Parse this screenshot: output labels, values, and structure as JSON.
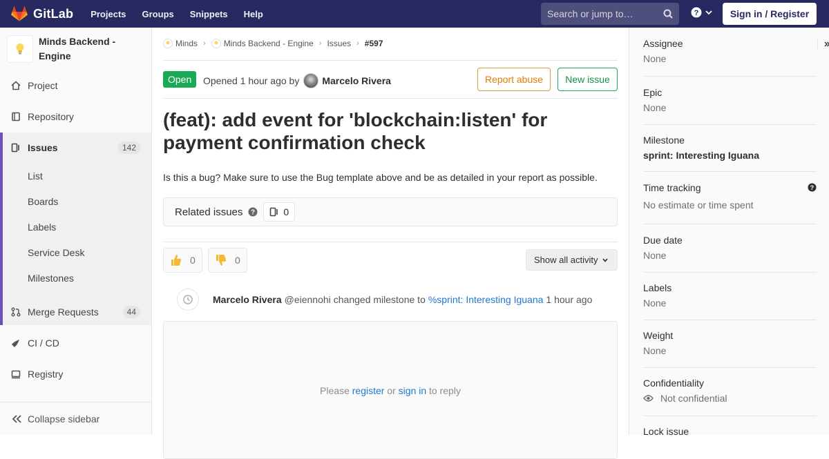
{
  "navbar": {
    "brand": "GitLab",
    "links": [
      "Projects",
      "Groups",
      "Snippets",
      "Help"
    ],
    "search_placeholder": "Search or jump to…",
    "signin_label": "Sign in / Register"
  },
  "sidebar": {
    "project_name": "Minds Backend - Engine",
    "items": [
      {
        "label": "Project"
      },
      {
        "label": "Repository"
      },
      {
        "label": "Issues",
        "count": "142"
      },
      {
        "label": "Merge Requests",
        "count": "44"
      },
      {
        "label": "CI / CD"
      },
      {
        "label": "Registry"
      }
    ],
    "issue_subitems": [
      "List",
      "Boards",
      "Labels",
      "Service Desk",
      "Milestones"
    ],
    "collapse_label": "Collapse sidebar"
  },
  "breadcrumbs": [
    "Minds",
    "Minds Backend - Engine",
    "Issues",
    "#597"
  ],
  "issue": {
    "status": "Open",
    "opened_text": "Opened 1 hour ago by",
    "author": "Marcelo Rivera",
    "report_abuse_label": "Report abuse",
    "new_issue_label": "New issue",
    "title": "(feat): add event for 'blockchain:listen' for payment confirmation check",
    "description": "Is this a bug? Make sure to use the Bug template above and be as detailed in your report as possible.",
    "related_title": "Related issues",
    "related_count": "0",
    "thumbs_up": "0",
    "thumbs_down": "0",
    "activity_filter": "Show all activity"
  },
  "note": {
    "author": "Marcelo Rivera",
    "handle": "@eiennohi",
    "action": "changed milestone to",
    "milestone_link": "%sprint: Interesting Iguana",
    "time": "1 hour ago"
  },
  "reply": {
    "prefix": "Please",
    "register": "register",
    "or": "or",
    "signin": "sign in",
    "suffix": "to reply"
  },
  "right_sidebar": {
    "assignee": {
      "title": "Assignee",
      "value": "None"
    },
    "epic": {
      "title": "Epic",
      "value": "None"
    },
    "milestone": {
      "title": "Milestone",
      "value": "sprint: Interesting Iguana"
    },
    "time_tracking": {
      "title": "Time tracking",
      "value": "No estimate or time spent"
    },
    "due_date": {
      "title": "Due date",
      "value": "None"
    },
    "labels": {
      "title": "Labels",
      "value": "None"
    },
    "weight": {
      "title": "Weight",
      "value": "None"
    },
    "confidentiality": {
      "title": "Confidentiality",
      "value": "Not confidential"
    },
    "lock_issue": {
      "title": "Lock issue"
    }
  },
  "colors": {
    "navbar": "#292961",
    "accent": "#6b4fbb",
    "open_badge": "#1aaa55",
    "link": "#1f78d1"
  }
}
